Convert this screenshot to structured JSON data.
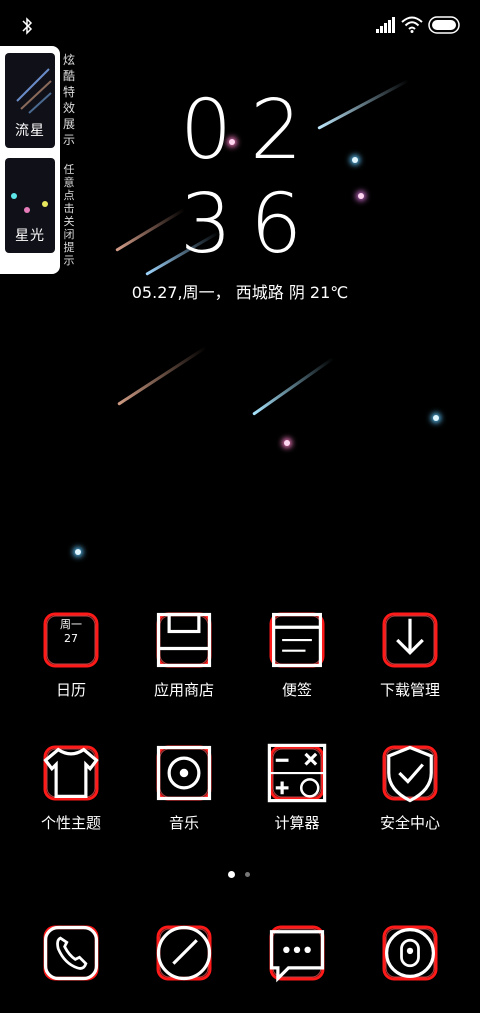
{
  "side_panel": {
    "effects": [
      {
        "label": "流星"
      },
      {
        "label": "星光"
      }
    ],
    "title_vertical": "炫酷特效展示",
    "hint_vertical": "任意点击关闭提示"
  },
  "lockscreen": {
    "hour": "02",
    "minute": "36",
    "date_weather": "05.27,周一，  西城路 阴 21℃"
  },
  "calendar_icon": {
    "weekday": "周一",
    "day": "27"
  },
  "apps": [
    {
      "label": "日历",
      "icon": "calendar-icon"
    },
    {
      "label": "应用商店",
      "icon": "app-store-icon"
    },
    {
      "label": "便签",
      "icon": "notes-icon"
    },
    {
      "label": "下载管理",
      "icon": "download-icon"
    },
    {
      "label": "个性主题",
      "icon": "theme-icon"
    },
    {
      "label": "音乐",
      "icon": "music-icon"
    },
    {
      "label": "计算器",
      "icon": "calculator-icon"
    },
    {
      "label": "安全中心",
      "icon": "security-icon"
    }
  ],
  "dock": [
    {
      "icon": "phone-icon"
    },
    {
      "icon": "browser-icon"
    },
    {
      "icon": "messages-icon"
    },
    {
      "icon": "camera-icon"
    }
  ],
  "pager": {
    "pages": 2,
    "current": 1
  },
  "colors": {
    "accent_red": "#ff1a1a",
    "background": "#000000"
  }
}
